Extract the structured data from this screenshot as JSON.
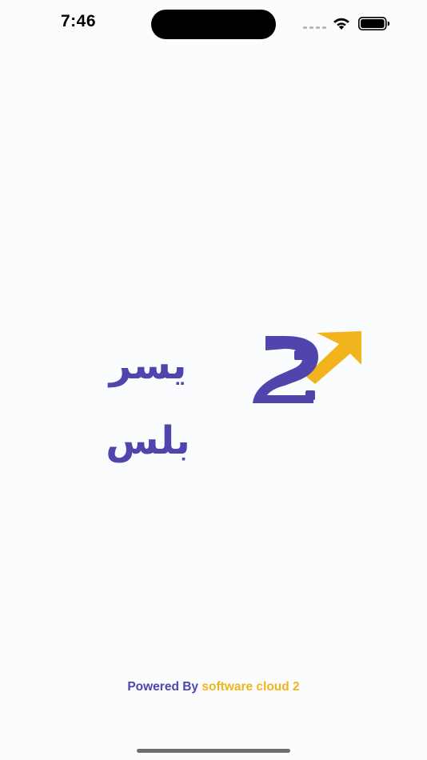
{
  "status_bar": {
    "time": "7:46",
    "icons": [
      "cellular-signal-icon",
      "wifi-icon",
      "battery-icon"
    ]
  },
  "logo": {
    "text": "يسر بلس",
    "mark_icon": "arrow-up-logo-icon",
    "colors": {
      "primary": "#4f45ad",
      "accent": "#f2b41c"
    }
  },
  "footer": {
    "prefix": "Powered By",
    "brand": "software cloud 2"
  },
  "colors": {
    "background": "#fbfcfd",
    "footer_prefix": "#4f45ad",
    "footer_brand": "#f2b41c"
  }
}
